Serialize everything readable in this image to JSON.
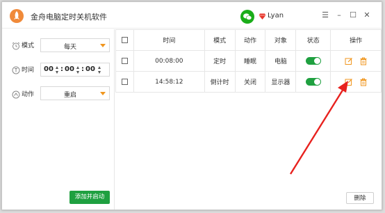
{
  "app": {
    "title": "金舟电脑定时关机软件",
    "user_name": "Lyan"
  },
  "window_controls": {
    "menu": "☰",
    "minimize": "–",
    "maximize": "☐",
    "close": "✕"
  },
  "sidebar": {
    "mode_label": "模式",
    "mode_value": "每天",
    "time_label": "时间",
    "time_hour": "00",
    "time_minute": "00",
    "time_second": "00",
    "action_label": "动作",
    "action_value": "重启",
    "add_button": "添加并启动"
  },
  "table": {
    "headers": [
      "",
      "时间",
      "模式",
      "动作",
      "对象",
      "状态",
      "操作"
    ],
    "rows": [
      {
        "time": "00:08:00",
        "mode": "定时",
        "action": "睡眠",
        "target": "电脑",
        "enabled": true
      },
      {
        "time": "14:58:12",
        "mode": "倒计时",
        "action": "关闭",
        "target": "显示器",
        "enabled": true
      }
    ]
  },
  "delete_button": "删除",
  "icons": {
    "logo": "rocket-icon",
    "wechat": "wechat-icon",
    "vip": "diamond-icon",
    "edit": "edit-icon",
    "trash": "trash-icon"
  },
  "colors": {
    "accent": "#1fa040",
    "orange": "#f0961e",
    "annotation_arrow": "#e8211e"
  }
}
